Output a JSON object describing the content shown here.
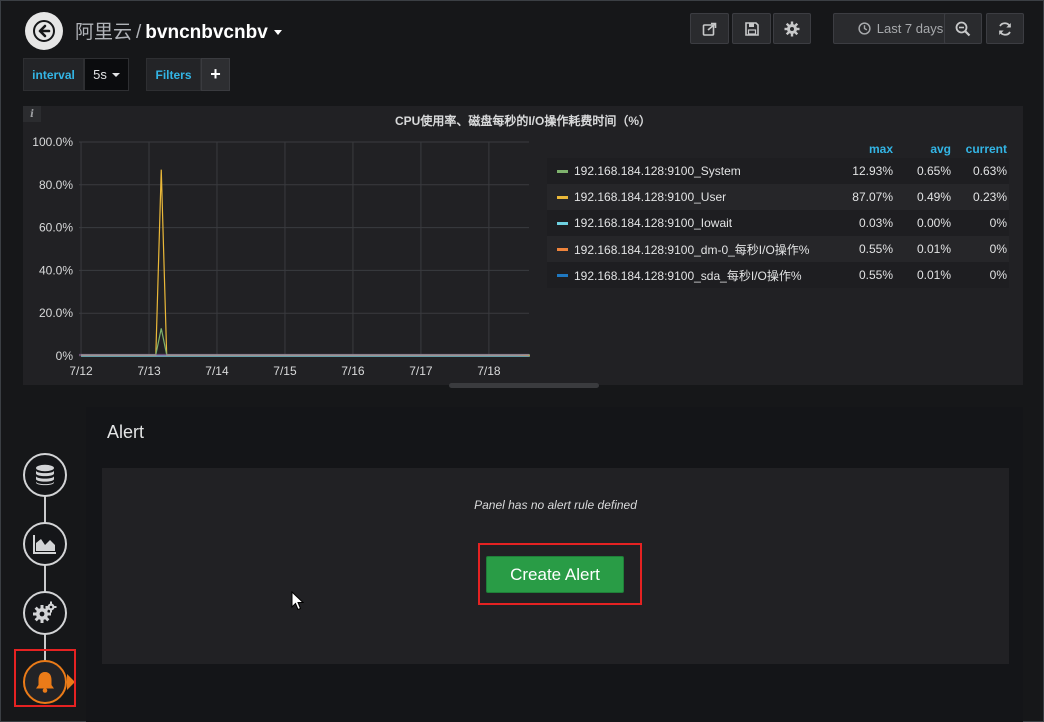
{
  "header": {
    "org": "阿里云",
    "separator": "/",
    "dashboard_title": "bvncnbvcnbv",
    "time_range": "Last 7 days"
  },
  "variables": {
    "interval_label": "interval",
    "interval_value": "5s",
    "filters_label": "Filters",
    "filters_add": "+"
  },
  "panel": {
    "info": "i",
    "title": "CPU使用率、磁盘每秒的I/O操作耗费时间（%）",
    "legend": {
      "headers": {
        "max": "max",
        "avg": "avg",
        "current": "current"
      },
      "rows": [
        {
          "name": "192.168.184.128:9100_System",
          "max": "12.93%",
          "avg": "0.65%",
          "current": "0.63%",
          "color": "#7eb26d"
        },
        {
          "name": "192.168.184.128:9100_User",
          "max": "87.07%",
          "avg": "0.49%",
          "current": "0.23%",
          "color": "#eab839"
        },
        {
          "name": "192.168.184.128:9100_Iowait",
          "max": "0.03%",
          "avg": "0.00%",
          "current": "0%",
          "color": "#6ed0e0"
        },
        {
          "name": "192.168.184.128:9100_dm-0_每秒I/O操作%",
          "max": "0.55%",
          "avg": "0.01%",
          "current": "0%",
          "color": "#ef843c"
        },
        {
          "name": "192.168.184.128:9100_sda_每秒I/O操作%",
          "max": "0.55%",
          "avg": "0.01%",
          "current": "0%",
          "color": "#1f78c1"
        }
      ]
    }
  },
  "chart_data": {
    "type": "line",
    "title": "CPU使用率、磁盘每秒的I/O操作耗费时间（%）",
    "x_ticks": [
      "7/12",
      "7/13",
      "7/14",
      "7/15",
      "7/16",
      "7/17",
      "7/18"
    ],
    "y_ticks": [
      "0%",
      "20.0%",
      "40.0%",
      "60.0%",
      "80.0%",
      "100.0%"
    ],
    "ylim": [
      0,
      100
    ],
    "grid": true,
    "legend_placement": "right",
    "series": [
      {
        "name": "192.168.184.128:9100_System",
        "color": "#7eb26d",
        "x": [
          0,
          0.5,
          1.1,
          1.18,
          1.26,
          2.0,
          3.0,
          4.0,
          5.0,
          5.9,
          6.4,
          6.6
        ],
        "y": [
          0.6,
          0.6,
          0.6,
          12.93,
          0.6,
          0.6,
          0.6,
          0.6,
          0.6,
          0.6,
          0.6,
          0.63
        ]
      },
      {
        "name": "192.168.184.128:9100_User",
        "color": "#eab839",
        "x": [
          0,
          0.5,
          1.1,
          1.18,
          1.26,
          2.0,
          3.0,
          4.0,
          5.0,
          5.9,
          6.4,
          6.6
        ],
        "y": [
          0.4,
          0.4,
          0.4,
          87.07,
          0.4,
          0.4,
          0.4,
          0.4,
          0.4,
          0.4,
          0.4,
          0.23
        ]
      },
      {
        "name": "192.168.184.128:9100_Iowait",
        "color": "#6ed0e0",
        "x": [
          0,
          6.6
        ],
        "y": [
          0,
          0
        ]
      },
      {
        "name": "192.168.184.128:9100_dm-0_每秒I/O操作%",
        "color": "#ef843c",
        "x": [
          0,
          6.6
        ],
        "y": [
          0.01,
          0
        ]
      },
      {
        "name": "192.168.184.128:9100_sda_每秒I/O操作%",
        "color": "#1f78c1",
        "x": [
          0,
          6.6
        ],
        "y": [
          0.01,
          0
        ]
      }
    ]
  },
  "alert": {
    "title": "Alert",
    "no_rule_text": "Panel has no alert rule defined",
    "create_button": "Create Alert"
  },
  "icons": {
    "back": "arrow-left-icon",
    "share": "share-icon",
    "save": "save-icon",
    "settings": "gear-icon",
    "clock": "clock-icon",
    "zoom_out": "zoom-out-icon",
    "refresh": "refresh-icon",
    "queries": "database-icon",
    "visualization": "chart-area-icon",
    "general": "cogs-icon",
    "alert": "bell-icon"
  }
}
